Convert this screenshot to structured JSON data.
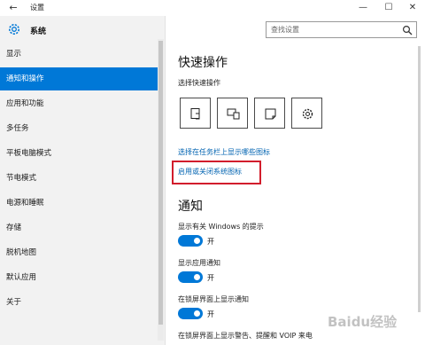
{
  "window": {
    "title": "设置",
    "back_icon": "back-arrow-icon",
    "controls": {
      "minimize": "—",
      "maximize": "☐",
      "close": "✕"
    }
  },
  "sidebar": {
    "header_label": "系统",
    "items": [
      {
        "label": "显示",
        "active": false
      },
      {
        "label": "通知和操作",
        "active": true
      },
      {
        "label": "应用和功能",
        "active": false
      },
      {
        "label": "多任务",
        "active": false
      },
      {
        "label": "平板电脑模式",
        "active": false
      },
      {
        "label": "节电模式",
        "active": false
      },
      {
        "label": "电源和睡眠",
        "active": false
      },
      {
        "label": "存储",
        "active": false
      },
      {
        "label": "脱机地图",
        "active": false
      },
      {
        "label": "默认应用",
        "active": false
      },
      {
        "label": "关于",
        "active": false
      }
    ]
  },
  "search": {
    "placeholder": "查找设置"
  },
  "main": {
    "quick_actions_title": "快速操作",
    "quick_actions_subtitle": "选择快速操作",
    "quick_action_icons": [
      "tablet-mode-icon",
      "connect-display-icon",
      "note-icon",
      "settings-gear-icon"
    ],
    "link_taskbar_icons": "选择在任务栏上显示哪些图标",
    "link_system_icons": "启用或关闭系统图标",
    "notifications_title": "通知",
    "toggles": [
      {
        "label": "显示有关 Windows 的提示",
        "state": "开"
      },
      {
        "label": "显示应用通知",
        "state": "开"
      },
      {
        "label": "在锁屏界面上显示通知",
        "state": "开"
      },
      {
        "label": "在锁屏界面上显示警告、提醒和 VOIP 来电",
        "state": ""
      }
    ]
  },
  "watermark": "Baidu经验",
  "colors": {
    "accent": "#0078d7",
    "link": "#0063b1",
    "highlight": "#d21d2c"
  }
}
